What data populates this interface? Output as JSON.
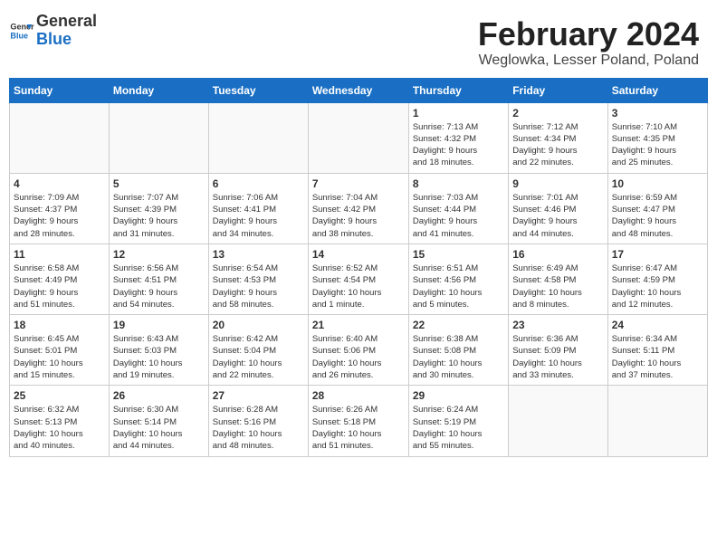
{
  "logo": {
    "general": "General",
    "blue": "Blue"
  },
  "header": {
    "title": "February 2024",
    "subtitle": "Weglowka, Lesser Poland, Poland"
  },
  "columns": [
    "Sunday",
    "Monday",
    "Tuesday",
    "Wednesday",
    "Thursday",
    "Friday",
    "Saturday"
  ],
  "weeks": [
    [
      {
        "day": "",
        "info": ""
      },
      {
        "day": "",
        "info": ""
      },
      {
        "day": "",
        "info": ""
      },
      {
        "day": "",
        "info": ""
      },
      {
        "day": "1",
        "info": "Sunrise: 7:13 AM\nSunset: 4:32 PM\nDaylight: 9 hours\nand 18 minutes."
      },
      {
        "day": "2",
        "info": "Sunrise: 7:12 AM\nSunset: 4:34 PM\nDaylight: 9 hours\nand 22 minutes."
      },
      {
        "day": "3",
        "info": "Sunrise: 7:10 AM\nSunset: 4:35 PM\nDaylight: 9 hours\nand 25 minutes."
      }
    ],
    [
      {
        "day": "4",
        "info": "Sunrise: 7:09 AM\nSunset: 4:37 PM\nDaylight: 9 hours\nand 28 minutes."
      },
      {
        "day": "5",
        "info": "Sunrise: 7:07 AM\nSunset: 4:39 PM\nDaylight: 9 hours\nand 31 minutes."
      },
      {
        "day": "6",
        "info": "Sunrise: 7:06 AM\nSunset: 4:41 PM\nDaylight: 9 hours\nand 34 minutes."
      },
      {
        "day": "7",
        "info": "Sunrise: 7:04 AM\nSunset: 4:42 PM\nDaylight: 9 hours\nand 38 minutes."
      },
      {
        "day": "8",
        "info": "Sunrise: 7:03 AM\nSunset: 4:44 PM\nDaylight: 9 hours\nand 41 minutes."
      },
      {
        "day": "9",
        "info": "Sunrise: 7:01 AM\nSunset: 4:46 PM\nDaylight: 9 hours\nand 44 minutes."
      },
      {
        "day": "10",
        "info": "Sunrise: 6:59 AM\nSunset: 4:47 PM\nDaylight: 9 hours\nand 48 minutes."
      }
    ],
    [
      {
        "day": "11",
        "info": "Sunrise: 6:58 AM\nSunset: 4:49 PM\nDaylight: 9 hours\nand 51 minutes."
      },
      {
        "day": "12",
        "info": "Sunrise: 6:56 AM\nSunset: 4:51 PM\nDaylight: 9 hours\nand 54 minutes."
      },
      {
        "day": "13",
        "info": "Sunrise: 6:54 AM\nSunset: 4:53 PM\nDaylight: 9 hours\nand 58 minutes."
      },
      {
        "day": "14",
        "info": "Sunrise: 6:52 AM\nSunset: 4:54 PM\nDaylight: 10 hours\nand 1 minute."
      },
      {
        "day": "15",
        "info": "Sunrise: 6:51 AM\nSunset: 4:56 PM\nDaylight: 10 hours\nand 5 minutes."
      },
      {
        "day": "16",
        "info": "Sunrise: 6:49 AM\nSunset: 4:58 PM\nDaylight: 10 hours\nand 8 minutes."
      },
      {
        "day": "17",
        "info": "Sunrise: 6:47 AM\nSunset: 4:59 PM\nDaylight: 10 hours\nand 12 minutes."
      }
    ],
    [
      {
        "day": "18",
        "info": "Sunrise: 6:45 AM\nSunset: 5:01 PM\nDaylight: 10 hours\nand 15 minutes."
      },
      {
        "day": "19",
        "info": "Sunrise: 6:43 AM\nSunset: 5:03 PM\nDaylight: 10 hours\nand 19 minutes."
      },
      {
        "day": "20",
        "info": "Sunrise: 6:42 AM\nSunset: 5:04 PM\nDaylight: 10 hours\nand 22 minutes."
      },
      {
        "day": "21",
        "info": "Sunrise: 6:40 AM\nSunset: 5:06 PM\nDaylight: 10 hours\nand 26 minutes."
      },
      {
        "day": "22",
        "info": "Sunrise: 6:38 AM\nSunset: 5:08 PM\nDaylight: 10 hours\nand 30 minutes."
      },
      {
        "day": "23",
        "info": "Sunrise: 6:36 AM\nSunset: 5:09 PM\nDaylight: 10 hours\nand 33 minutes."
      },
      {
        "day": "24",
        "info": "Sunrise: 6:34 AM\nSunset: 5:11 PM\nDaylight: 10 hours\nand 37 minutes."
      }
    ],
    [
      {
        "day": "25",
        "info": "Sunrise: 6:32 AM\nSunset: 5:13 PM\nDaylight: 10 hours\nand 40 minutes."
      },
      {
        "day": "26",
        "info": "Sunrise: 6:30 AM\nSunset: 5:14 PM\nDaylight: 10 hours\nand 44 minutes."
      },
      {
        "day": "27",
        "info": "Sunrise: 6:28 AM\nSunset: 5:16 PM\nDaylight: 10 hours\nand 48 minutes."
      },
      {
        "day": "28",
        "info": "Sunrise: 6:26 AM\nSunset: 5:18 PM\nDaylight: 10 hours\nand 51 minutes."
      },
      {
        "day": "29",
        "info": "Sunrise: 6:24 AM\nSunset: 5:19 PM\nDaylight: 10 hours\nand 55 minutes."
      },
      {
        "day": "",
        "info": ""
      },
      {
        "day": "",
        "info": ""
      }
    ]
  ]
}
